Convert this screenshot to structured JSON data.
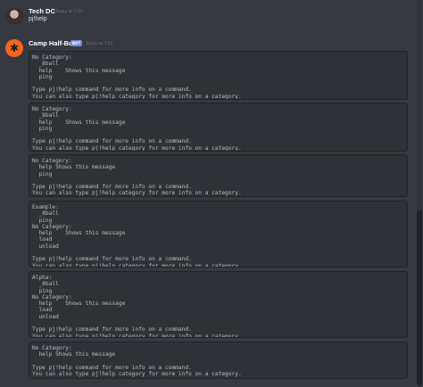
{
  "messages": [
    {
      "author": "Tech DC",
      "timestamp": "Today at 7:51",
      "text": "pj!help"
    },
    {
      "author": "Camp Half-Bot",
      "badge": "BOT",
      "timestamp": "Today at 7:51",
      "embeds": [
        "No Category:\n  _8ball\n  help    Shows this message\n  ping\n\nType pj!help command for more info on a command.\nYou can also type pj!help category for more info on a category.",
        "No Category:\n  _8ball\n  help    Shows this message\n  ping\n\nType pj!help command for more info on a command.\nYou can also type pj!help category for more info on a category.",
        "No Category:\n  help Shows this message\n  ping\n\nType pj!help command for more info on a command.\nYou can also type pj!help category for more info on a category.",
        "Example:\n  _8ball\n  ping\nNo Category:\n  help    Shows this message\n  load\n  unload\n\nType pj!help command for more info on a command.\nYou can also type pj!help category for more info on a category.",
        "Alpha:\n  _8ball\n  ping\nNo Category:\n  help    Shows this message\n  load\n  unload\n\nType pj!help command for more info on a command.\nYou can also type pj!help category for more info on a category.",
        "No Category:\n  help Shows this message\n\nType pj!help command for more info on a command.\nYou can also type pj!help category for more info on a category."
      ]
    }
  ],
  "icons": {
    "user_avatar": "avatar-icon",
    "bot_avatar": "camp-half-bot-logo-icon"
  },
  "colors": {
    "background": "#36393f",
    "code_background": "#2f3136",
    "bot_badge": "#7289da",
    "bot_avatar": "#f26522"
  }
}
